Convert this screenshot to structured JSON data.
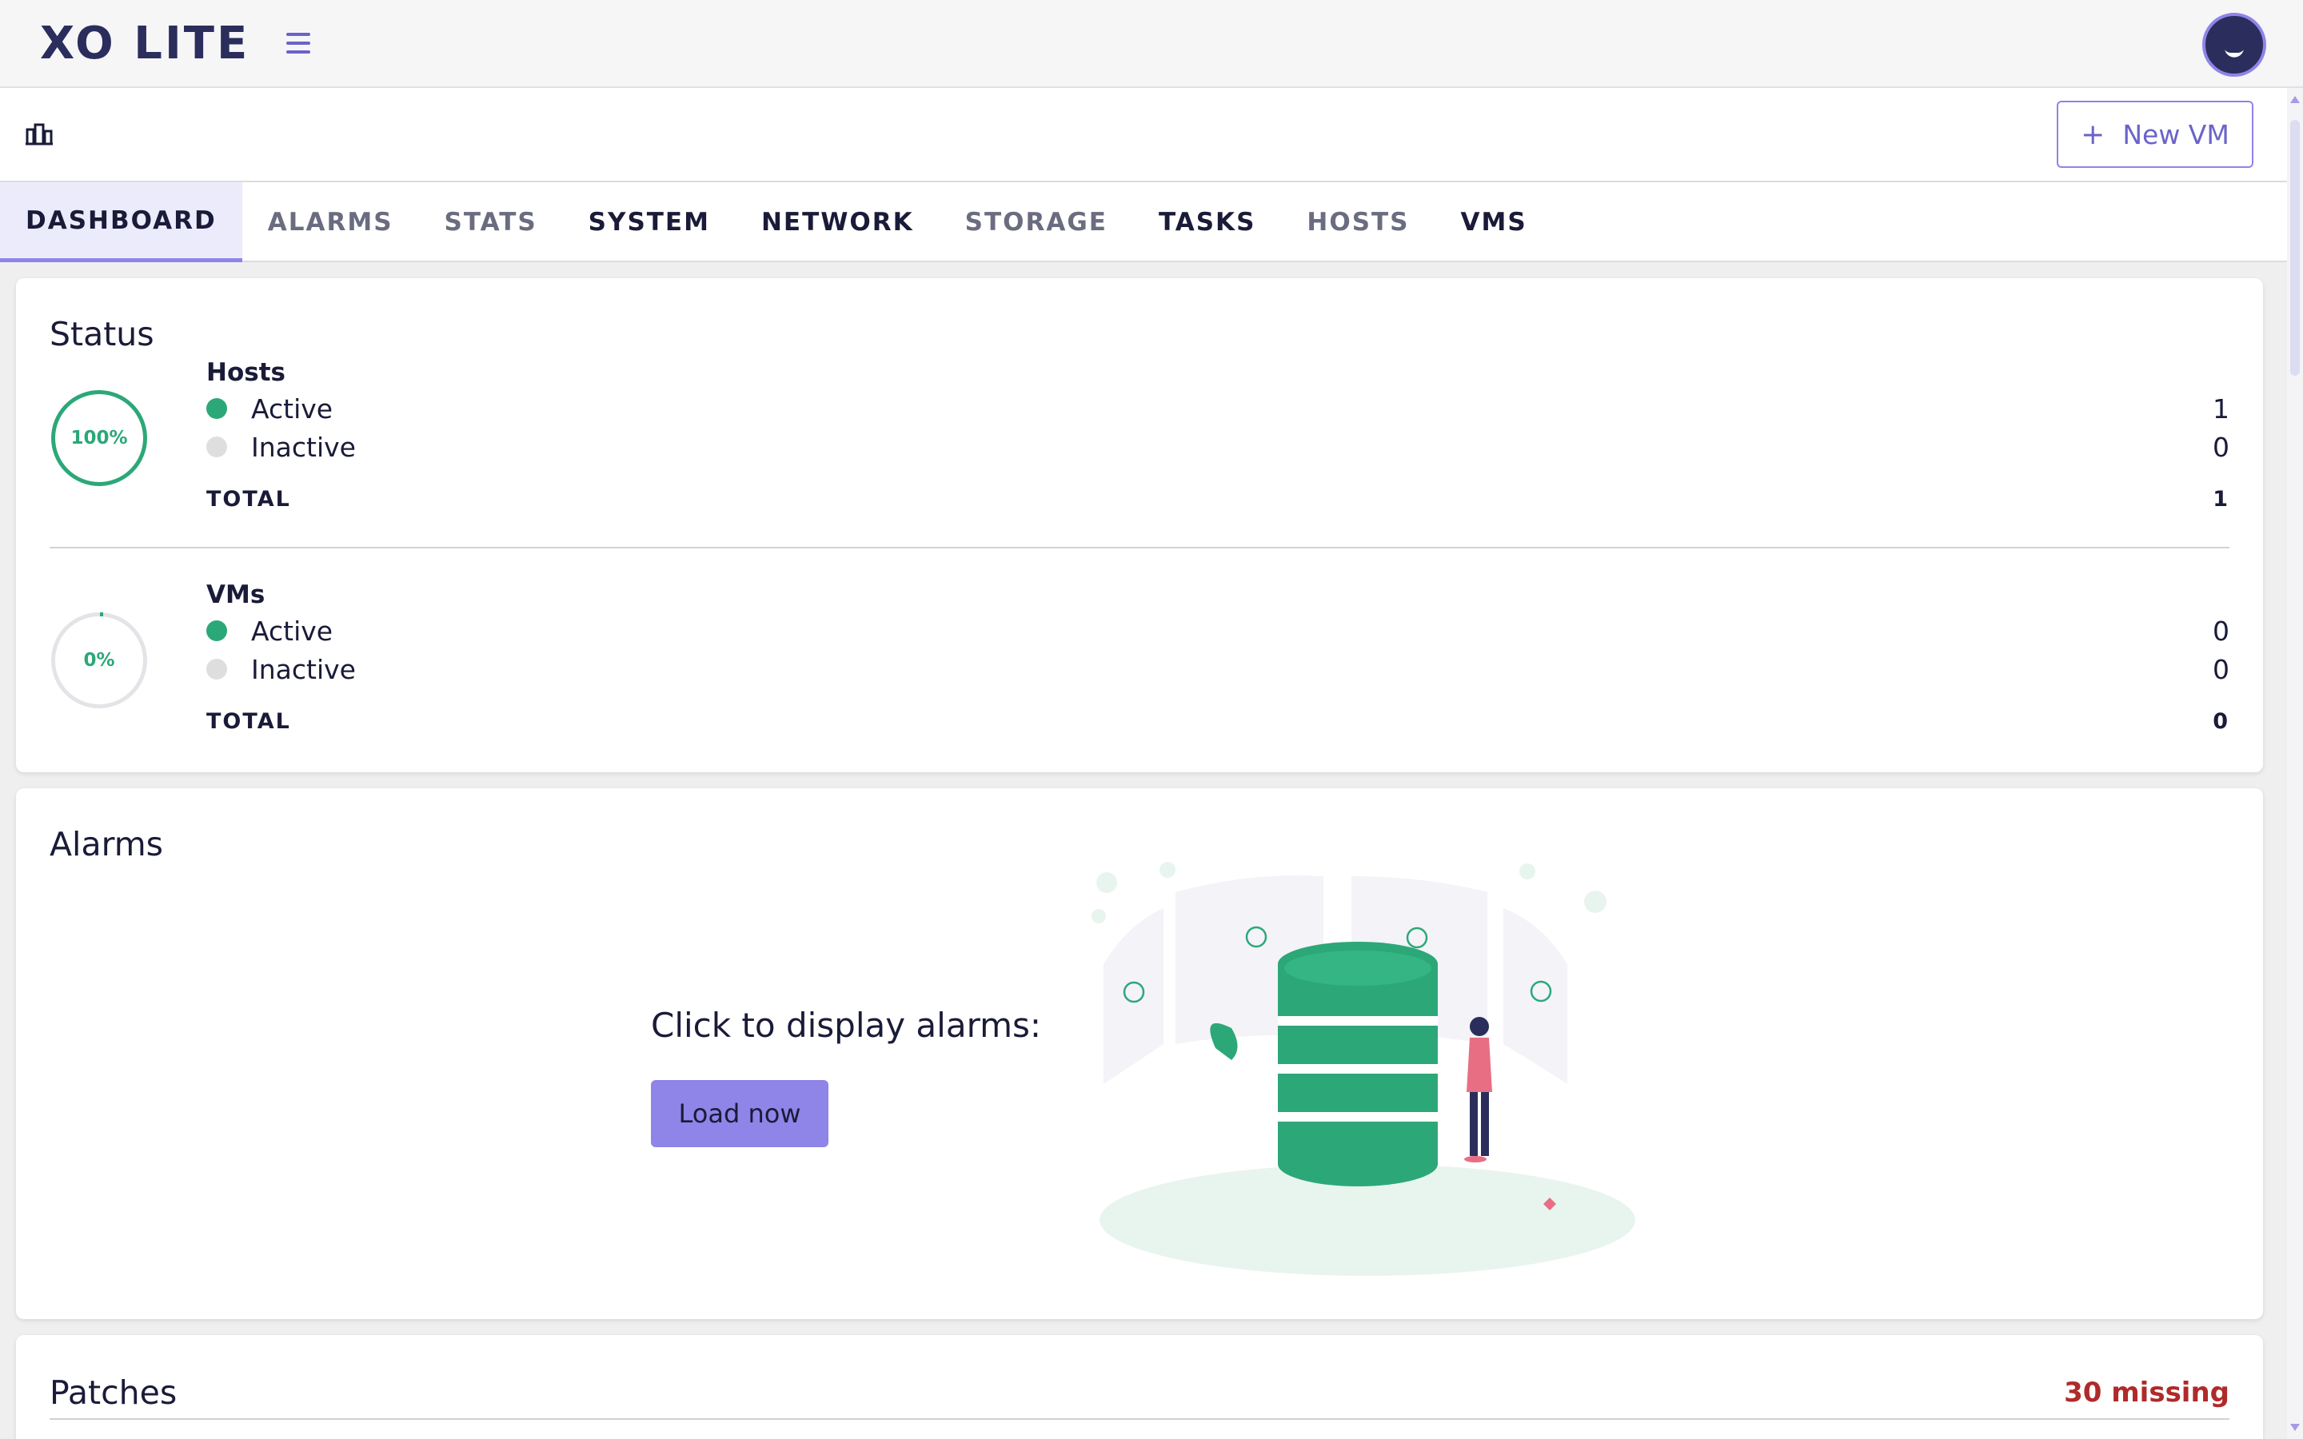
{
  "app": {
    "logo": "XO LITE"
  },
  "toolbar": {
    "new_vm_label": "New VM",
    "new_vm_icon": "plus"
  },
  "tabs": [
    {
      "label": "DASHBOARD",
      "active": true
    },
    {
      "label": "ALARMS"
    },
    {
      "label": "STATS"
    },
    {
      "label": "SYSTEM"
    },
    {
      "label": "NETWORK"
    },
    {
      "label": "STORAGE"
    },
    {
      "label": "TASKS"
    },
    {
      "label": "HOSTS"
    },
    {
      "label": "VMS"
    }
  ],
  "status": {
    "title": "Status",
    "hosts": {
      "label": "Hosts",
      "percent": "100%",
      "active_label": "Active",
      "active_value": "1",
      "inactive_label": "Inactive",
      "inactive_value": "0",
      "total_label": "TOTAL",
      "total_value": "1"
    },
    "vms": {
      "label": "VMs",
      "percent": "0%",
      "active_label": "Active",
      "active_value": "0",
      "inactive_label": "Inactive",
      "inactive_value": "0",
      "total_label": "TOTAL",
      "total_value": "0"
    }
  },
  "alarms": {
    "title": "Alarms",
    "prompt": "Click to display alarms:",
    "load_button": "Load now"
  },
  "patches": {
    "title": "Patches",
    "missing": "30 missing"
  },
  "colors": {
    "accent": "#8f84e8",
    "success": "#2ca878",
    "danger": "#b02a2a",
    "text": "#1a1b38"
  }
}
